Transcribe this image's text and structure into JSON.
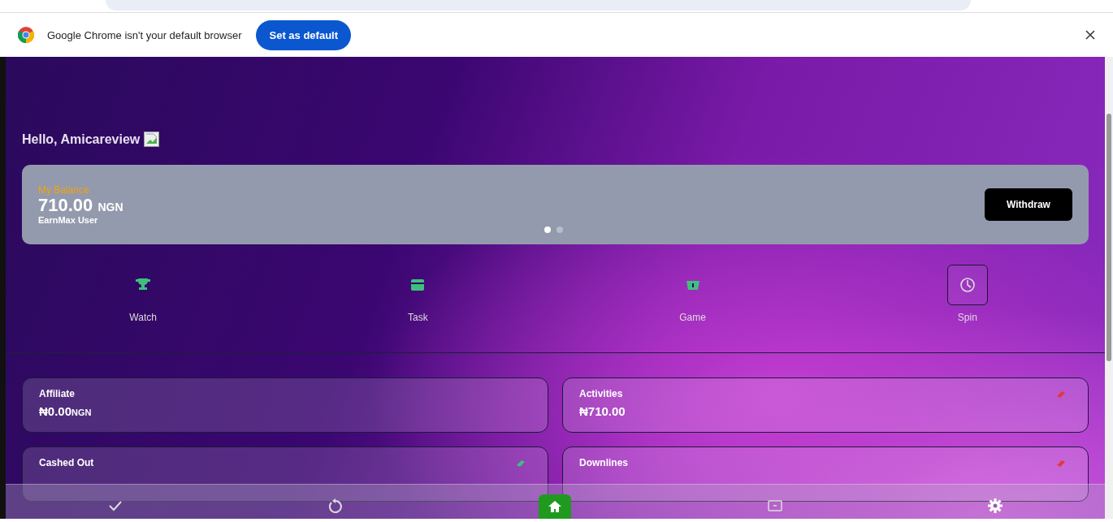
{
  "infobar": {
    "message": "Google Chrome isn't your default browser",
    "button": "Set as default"
  },
  "greeting": "Hello, Amicareview",
  "balance": {
    "label": "My Balance",
    "amount": "710.00",
    "currency": "NGN",
    "subtitle": "EarnMax User",
    "action": "Withdraw",
    "pages": [
      {
        "selected": true
      },
      {
        "selected": false
      }
    ]
  },
  "shortcuts": [
    {
      "label": "Watch",
      "kind": "trophy",
      "selected": false
    },
    {
      "label": "Task",
      "kind": "card",
      "selected": false
    },
    {
      "label": "Game",
      "kind": "gift",
      "selected": false
    },
    {
      "label": "Spin",
      "kind": "clock",
      "selected": true
    }
  ],
  "stats": [
    {
      "label": "Affiliate",
      "value": "₦0.00",
      "unit": "NGN"
    },
    {
      "label": "Activities",
      "value": "₦710.00",
      "color": "#e53935"
    },
    {
      "label": "Cashed Out",
      "color": "#3fbf7f"
    },
    {
      "label": "Downlines",
      "color": "#e53935"
    }
  ],
  "nav": [
    {
      "kind": "check",
      "selected": false
    },
    {
      "kind": "refresh",
      "selected": false
    },
    {
      "kind": "home",
      "selected": true
    },
    {
      "kind": "card",
      "selected": false
    },
    {
      "kind": "gear",
      "selected": false
    }
  ]
}
